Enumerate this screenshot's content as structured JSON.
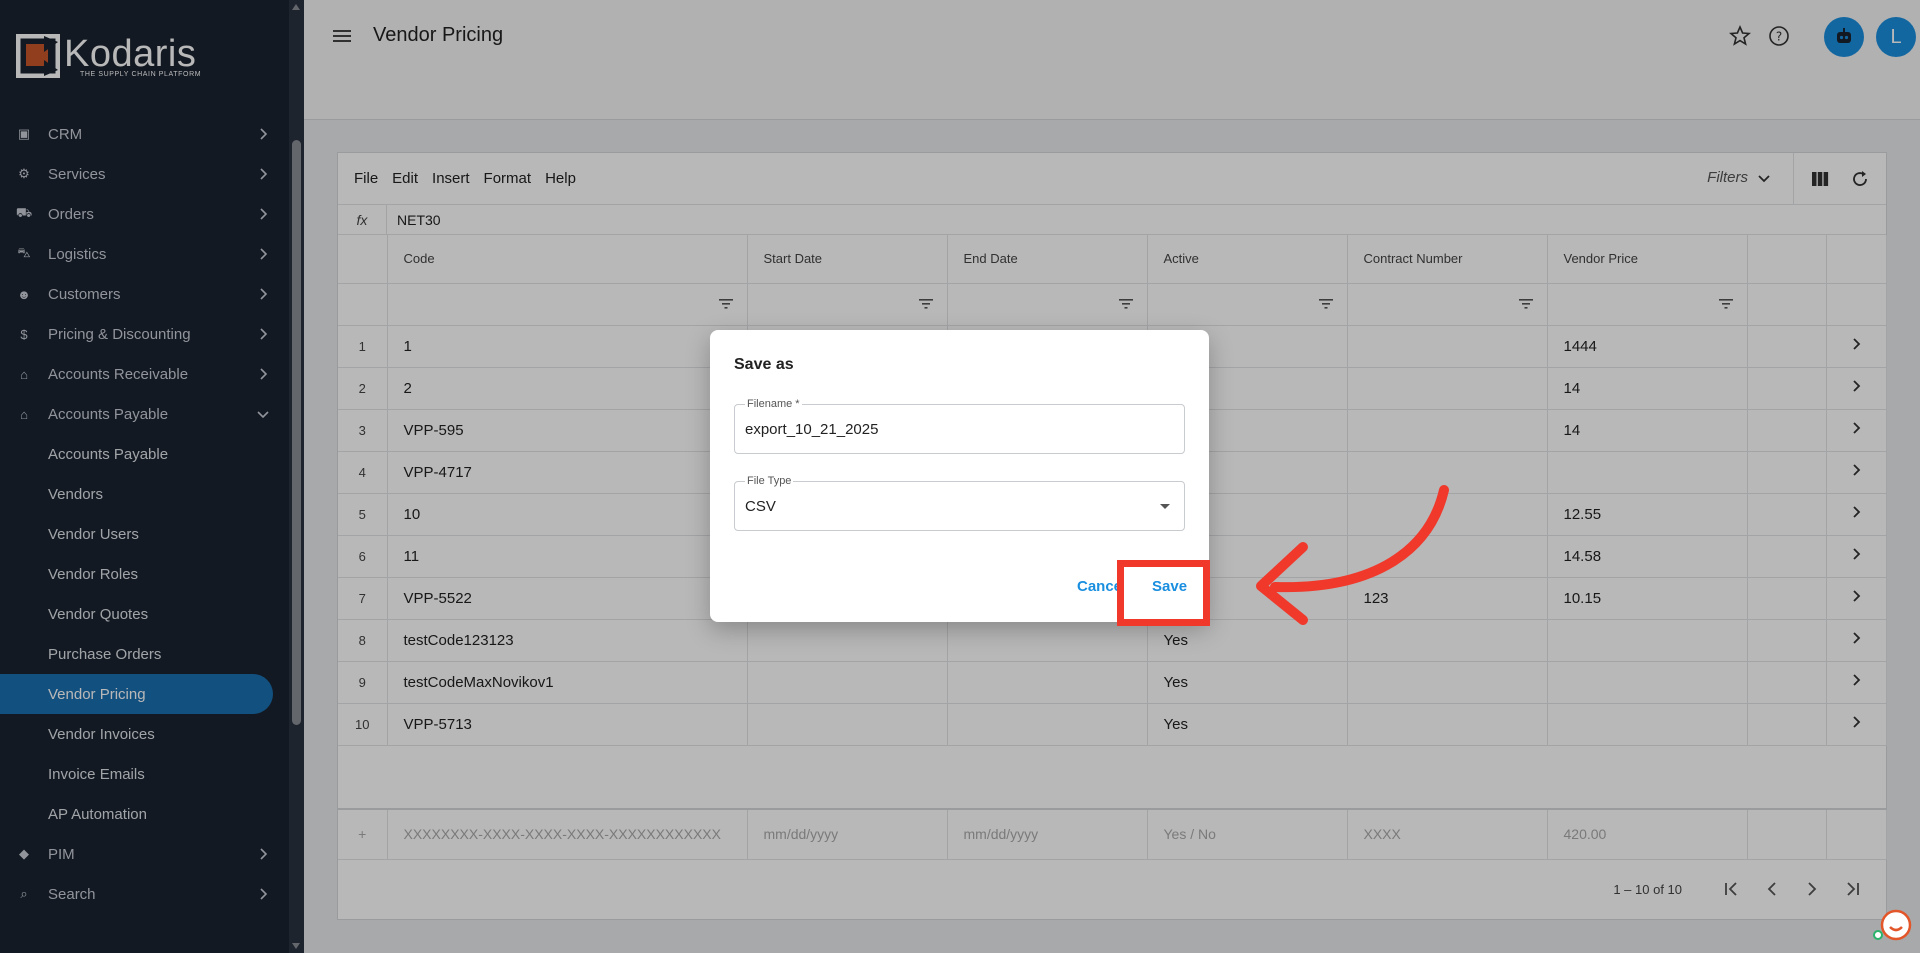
{
  "app": {
    "logo_name": "Kodaris",
    "logo_tagline": "THE SUPPLY CHAIN PLATFORM"
  },
  "sidebar": {
    "items": [
      {
        "label": "CRM",
        "icon": "crm-icon"
      },
      {
        "label": "Services",
        "icon": "services-icon"
      },
      {
        "label": "Orders",
        "icon": "truck-icon"
      },
      {
        "label": "Logistics",
        "icon": "logistics-icon"
      },
      {
        "label": "Customers",
        "icon": "users-icon"
      },
      {
        "label": "Pricing & Discounting",
        "icon": "dollar-icon"
      },
      {
        "label": "Accounts Receivable",
        "icon": "bank-icon"
      },
      {
        "label": "Accounts Payable",
        "icon": "bank-icon"
      }
    ],
    "sub_items": [
      "Accounts Payable",
      "Vendors",
      "Vendor Users",
      "Vendor Roles",
      "Vendor Quotes",
      "Purchase Orders",
      "Vendor Pricing",
      "Vendor Invoices",
      "Invoice Emails",
      "AP Automation"
    ],
    "bottom_items": [
      {
        "label": "PIM",
        "icon": "tag-icon"
      },
      {
        "label": "Search",
        "icon": "search-icon"
      }
    ],
    "active_item": "Vendor Pricing"
  },
  "header": {
    "title": "Vendor Pricing",
    "avatar_initial": "L"
  },
  "toolbar": {
    "menus": [
      "File",
      "Edit",
      "Insert",
      "Format",
      "Help"
    ],
    "filters_label": "Filters"
  },
  "formula_bar": {
    "label": "fx",
    "value": "NET30"
  },
  "grid": {
    "columns": [
      "Code",
      "Start Date",
      "End Date",
      "Active",
      "Contract Number",
      "Vendor Price"
    ],
    "rows": [
      {
        "n": "1",
        "code": "1",
        "start": "",
        "end": "",
        "active": "",
        "contract": "",
        "price": "1444"
      },
      {
        "n": "2",
        "code": "2",
        "start": "",
        "end": "",
        "active": "",
        "contract": "",
        "price": "14"
      },
      {
        "n": "3",
        "code": "VPP-595",
        "start": "",
        "end": "",
        "active": "",
        "contract": "",
        "price": "14"
      },
      {
        "n": "4",
        "code": "VPP-4717",
        "start": "",
        "end": "",
        "active": "",
        "contract": "",
        "price": ""
      },
      {
        "n": "5",
        "code": "10",
        "start": "",
        "end": "",
        "active": "",
        "contract": "",
        "price": "12.55"
      },
      {
        "n": "6",
        "code": "11",
        "start": "",
        "end": "",
        "active": "",
        "contract": "",
        "price": "14.58"
      },
      {
        "n": "7",
        "code": "VPP-5522",
        "start": "",
        "end": "",
        "active": "",
        "contract": "123",
        "price": "10.15"
      },
      {
        "n": "8",
        "code": "testCode123123",
        "start": "",
        "end": "",
        "active": "Yes",
        "contract": "",
        "price": ""
      },
      {
        "n": "9",
        "code": "testCodeMaxNovikov1",
        "start": "",
        "end": "",
        "active": "Yes",
        "contract": "",
        "price": ""
      },
      {
        "n": "10",
        "code": "VPP-5713",
        "start": "",
        "end": "",
        "active": "Yes",
        "contract": "",
        "price": ""
      }
    ],
    "new_row_placeholders": {
      "code": "XXXXXXXX-XXXX-XXXX-XXXX-XXXXXXXXXXXX",
      "start": "mm/dd/yyyy",
      "end": "mm/dd/yyyy",
      "active": "Yes / No",
      "contract": "XXXX",
      "price": "420.00"
    },
    "pagination": "1 – 10 of 10"
  },
  "dialog": {
    "title": "Save as",
    "filename_label": "Filename *",
    "filename_value": "export_10_21_2025",
    "filetype_label": "File Type",
    "filetype_value": "CSV",
    "cancel_label": "Cancel",
    "save_label": "Save"
  },
  "colors": {
    "accent": "#1a8fe0",
    "sidebar_bg": "#1a2330",
    "highlight": "#f0382b"
  }
}
